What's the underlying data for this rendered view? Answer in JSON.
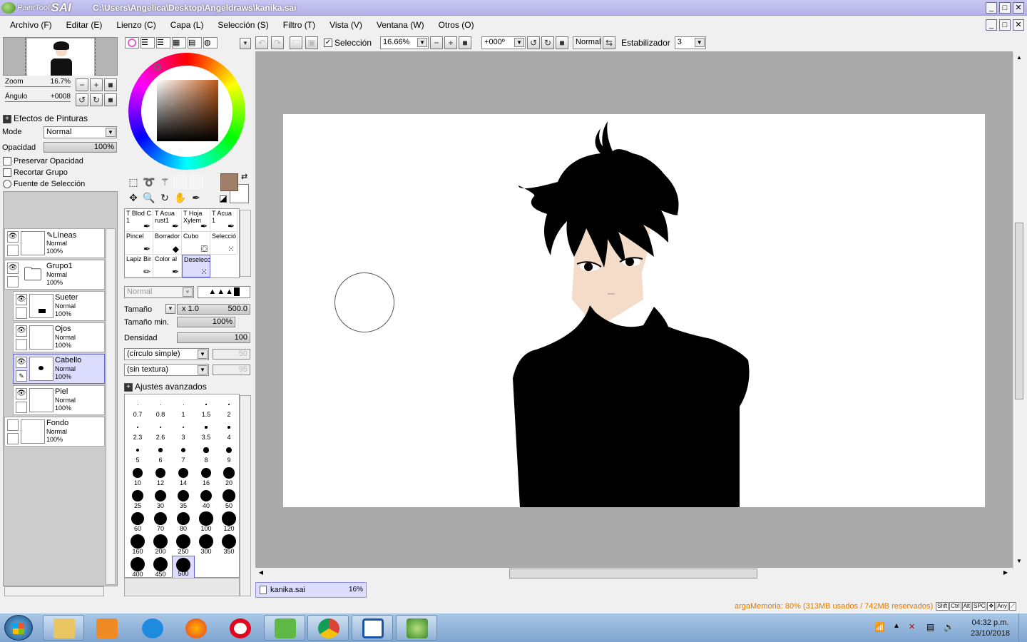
{
  "titlebar": {
    "app_name_1": "PaintTool",
    "app_name_2": "SAI",
    "path": "C:\\Users\\Angelica\\Desktop\\Angeldraws\\kanika.sai"
  },
  "menu": [
    "Archivo (F)",
    "Editar (E)",
    "Lienzo (C)",
    "Capa (L)",
    "Selección (S)",
    "Filtro (T)",
    "Vista (V)",
    "Ventana (W)",
    "Otros (O)"
  ],
  "navigator": {
    "zoom_label": "Zoom",
    "zoom_value": "16.7%",
    "angle_label": "Ángulo",
    "angle_value": "+0008"
  },
  "paint_effects": {
    "header": "Efectos de Pinturas",
    "mode_label": "Mode",
    "mode_value": "Normal",
    "opacity_label": "Opacidad",
    "opacity_value": "100%",
    "preserve_opacity": "Preservar Opacidad",
    "clip_group": "Recortar Grupo",
    "selection_source": "Fuente de Selección"
  },
  "layers": [
    {
      "name": "Líneas",
      "mode": "Normal",
      "opacity": "100%"
    },
    {
      "name": "Grupo1",
      "mode": "Normal",
      "opacity": "100%"
    },
    {
      "name": "Sueter",
      "mode": "Normal",
      "opacity": "100%"
    },
    {
      "name": "Ojos",
      "mode": "Normal",
      "opacity": "100%"
    },
    {
      "name": "Cabello",
      "mode": "Normal",
      "opacity": "100%"
    },
    {
      "name": "Piel",
      "mode": "Normal",
      "opacity": "100%"
    },
    {
      "name": "Fondo",
      "mode": "Normal",
      "opacity": "100%"
    }
  ],
  "tools": [
    {
      "label": "T Blod C 1"
    },
    {
      "label": "T Acua rust1"
    },
    {
      "label": "T Hoja Xylem"
    },
    {
      "label": "T Acua 1"
    },
    {
      "label": "Pincel"
    },
    {
      "label": "Borrador"
    },
    {
      "label": "Cubo"
    },
    {
      "label": "Selecció"
    },
    {
      "label": "Lapiz Bir"
    },
    {
      "label": "Color al"
    },
    {
      "label": "Deselecc"
    }
  ],
  "brush": {
    "blend_mode": "Normal",
    "size_label": "Tamaño",
    "size_mult": "x 1.0",
    "size_value": "500.0",
    "min_size_label": "Tamaño min.",
    "min_size_value": "100%",
    "density_label": "Densidad",
    "density_value": "100",
    "shape": "(círculo simple)",
    "shape_value": "50",
    "texture": "(sin textura)",
    "texture_value": "95",
    "advanced": "Ajustes avanzados"
  },
  "brush_sizes": [
    "0.7",
    "0.8",
    "1",
    "1.5",
    "2",
    "2.3",
    "2.6",
    "3",
    "3.5",
    "4",
    "5",
    "6",
    "7",
    "8",
    "9",
    "10",
    "12",
    "14",
    "16",
    "20",
    "25",
    "30",
    "35",
    "40",
    "50",
    "60",
    "70",
    "80",
    "100",
    "120",
    "160",
    "200",
    "250",
    "300",
    "350",
    "400",
    "450",
    "500"
  ],
  "toolbar": {
    "selection_label": "Selección",
    "zoom": "16.66%",
    "angle": "+000º",
    "blend": "Normal",
    "stabilizer_label": "Estabilizador",
    "stabilizer_value": "3"
  },
  "file_tab": {
    "name": "kanika.sai",
    "zoom": "16%"
  },
  "status": {
    "memory": "argaMemoria: 80% (313MB usados / 742MB reservados)",
    "keys": [
      "Shft",
      "Ctrl",
      "Alt",
      "SPC",
      "Any"
    ]
  },
  "taskbar": {
    "time": "04:32 p.m.",
    "date": "23/10/2018"
  },
  "colors": {
    "current_fg": "#a07e68",
    "accent_sel": "#dcdcff",
    "titlebar": "#b7b4ec"
  }
}
